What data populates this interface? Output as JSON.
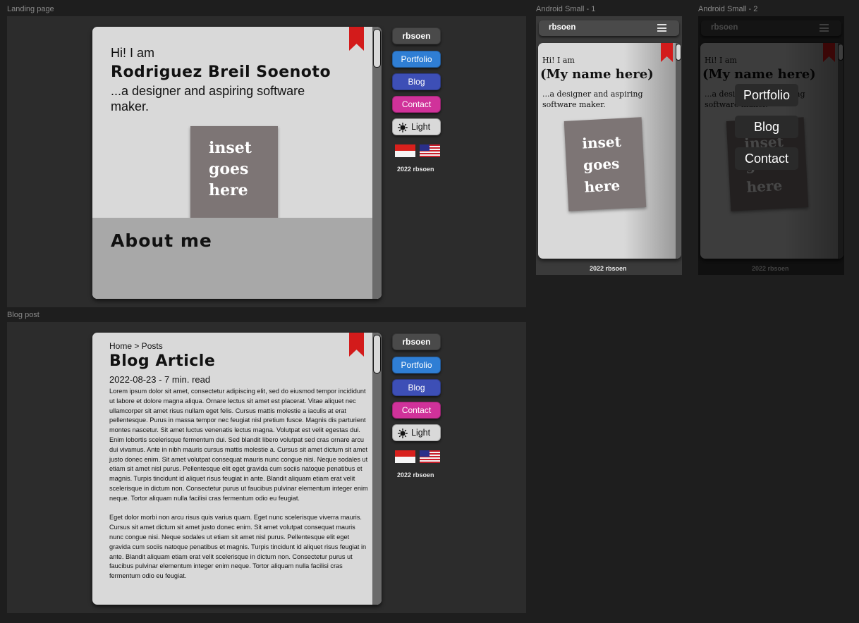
{
  "frames": {
    "landing_label": "Landing page",
    "blog_label": "Blog post",
    "android1_label": "Android Small - 1",
    "android2_label": "Android Small - 2"
  },
  "nav": {
    "brand": "rbsoen",
    "portfolio": "Portfolio",
    "blog": "Blog",
    "contact": "Contact",
    "theme": "Light",
    "footer": "2022 rbsoen"
  },
  "landing": {
    "greeting": "Hi! I am",
    "name": "Rodriguez Breil Soenoto",
    "tagline": "...a designer and aspiring software maker.",
    "inset": [
      "inset",
      "goes",
      "here"
    ],
    "about_title": "About me"
  },
  "blog": {
    "breadcrumb": "Home > Posts",
    "title": "Blog Article",
    "meta": "2022-08-23 - 7 min. read",
    "paragraphs": [
      "Lorem ipsum dolor sit amet, consectetur adipiscing elit, sed do eiusmod tempor incididunt ut labore et dolore magna aliqua. Ornare lectus sit amet est placerat. Vitae aliquet nec ullamcorper sit amet risus nullam eget felis. Cursus mattis molestie a iaculis at erat pellentesque. Purus in massa tempor nec feugiat nisl pretium fusce. Magnis dis parturient montes nascetur. Sit amet luctus venenatis lectus magna. Volutpat est velit egestas dui. Enim lobortis scelerisque fermentum dui. Sed blandit libero volutpat sed cras ornare arcu dui vivamus. Ante in nibh mauris cursus mattis molestie a. Cursus sit amet dictum sit amet justo donec enim. Sit amet volutpat consequat mauris nunc congue nisi. Neque sodales ut etiam sit amet nisl purus. Pellentesque elit eget gravida cum sociis natoque penatibus et magnis. Turpis tincidunt id aliquet risus feugiat in ante. Blandit aliquam etiam erat velit scelerisque in dictum non. Consectetur purus ut faucibus pulvinar elementum integer enim neque. Tortor aliquam nulla facilisi cras fermentum odio eu feugiat.",
      "Eget dolor morbi non arcu risus quis varius quam. Eget nunc scelerisque viverra mauris. Cursus sit amet dictum sit amet justo donec enim. Sit amet volutpat consequat mauris nunc congue nisi. Neque sodales ut etiam sit amet nisl purus. Pellentesque elit eget gravida cum sociis natoque penatibus et magnis. Turpis tincidunt id aliquet risus feugiat in ante. Blandit aliquam etiam erat velit scelerisque in dictum non. Consectetur purus ut faucibus pulvinar elementum integer enim neque. Tortor aliquam nulla facilisi cras fermentum odio eu feugiat."
    ]
  },
  "mobile": {
    "greeting": "Hi! I am",
    "name": "(My name here)",
    "tagline": "...a designer and aspiring software maker.",
    "inset": [
      "inset",
      "goes",
      "here"
    ],
    "menu": [
      "Portfolio",
      "Blog",
      "Contact"
    ]
  },
  "colors": {
    "bookmark": "#d31b1b",
    "portfolio": "#2f7ed4",
    "blog": "#3d4fb6",
    "contact": "#d0329a"
  }
}
